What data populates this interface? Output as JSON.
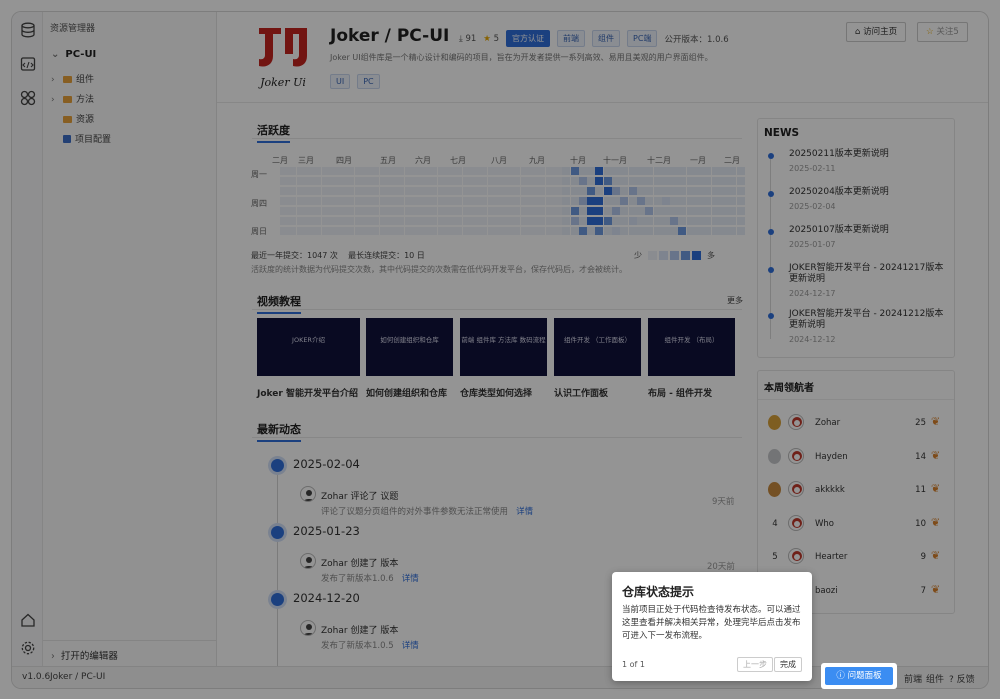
{
  "explorer": {
    "title": "资源管理器",
    "project": "PC-UI",
    "items": [
      {
        "label": "组件",
        "kind": "folder",
        "expandable": true
      },
      {
        "label": "方法",
        "kind": "folder",
        "expandable": true
      },
      {
        "label": "资源",
        "kind": "folder",
        "expandable": false
      },
      {
        "label": "项目配置",
        "kind": "file",
        "expandable": false
      }
    ],
    "open_editors": "打开的编辑器"
  },
  "statusbar": {
    "version": "v1.0.6",
    "path": "Joker / PC-UI",
    "right_items": [
      "前端",
      "组件",
      "反馈"
    ]
  },
  "header": {
    "logo_text": "Joker Ui",
    "title": "Joker / PC-UI",
    "downloads": "91",
    "stars": "5",
    "tags": [
      "官方认证",
      "前端",
      "组件",
      "PC端"
    ],
    "version_label": "公开版本：1.0.6",
    "description": "Joker UI组件库是一个精心设计和编码的项目，旨在为开发者提供一系列高效、易用且美观的用户界面组件。",
    "chips": [
      "UI",
      "PC"
    ],
    "visit_button": "访问主页",
    "follow_button": "关注5"
  },
  "activity": {
    "title": "活跃度",
    "months": [
      "二月",
      "三月",
      "四月",
      "五月",
      "六月",
      "七月",
      "八月",
      "九月",
      "十月",
      "十一月",
      "十二月",
      "一月",
      "二月"
    ],
    "days": [
      "周一",
      "周四",
      "周日"
    ],
    "summary_commits": "最近一年提交：1047 次",
    "summary_streak": "最长连续提交：10 日",
    "note": "活跃度的统计数据为代码提交次数，其中代码提交的次数需在低代码开发平台，保存代码后，才会被统计。",
    "legend_less": "少",
    "legend_more": "多",
    "colors": [
      "#eef2f9",
      "#d9e4f6",
      "#b3c9ee",
      "#6f9be2",
      "#2f6fdb"
    ]
  },
  "videos": {
    "title": "视频教程",
    "more": "更多",
    "items": [
      {
        "thumb": "JOKER介绍",
        "label": "Joker 智能开发平台介绍"
      },
      {
        "thumb": "如何创建组织和仓库",
        "label": "如何创建组织和仓库"
      },
      {
        "thumb": "前端 组件库 方法库 数码流程",
        "label": "仓库类型如何选择"
      },
      {
        "thumb": "组件开发 （工作面板）",
        "label": "认识工作面板"
      },
      {
        "thumb": "组件开发 （布局）",
        "label": "布局 - 组件开发"
      }
    ]
  },
  "feed": {
    "title": "最新动态",
    "groups": [
      {
        "date": "2025-02-04",
        "user": "Zohar",
        "action": "评论了 议题",
        "detail": "评论了议题分页组件的对外事件参数无法正常使用",
        "link": "详情",
        "ago": "9天前"
      },
      {
        "date": "2025-01-23",
        "user": "Zohar",
        "action": "创建了 版本",
        "detail": "发布了新版本1.0.6",
        "link": "详情",
        "ago": "20天前"
      },
      {
        "date": "2024-12-20",
        "user": "Zohar",
        "action": "创建了 版本",
        "detail": "发布了新版本1.0.5",
        "link": "详情",
        "ago": ""
      }
    ]
  },
  "news": {
    "title": "NEWS",
    "items": [
      {
        "title": "20250211版本更新说明",
        "date": "2025-02-11"
      },
      {
        "title": "20250204版本更新说明",
        "date": "2025-02-04"
      },
      {
        "title": "20250107版本更新说明",
        "date": "2025-01-07"
      },
      {
        "title": "JOKER智能开发平台 - 20241217版本更新说明",
        "date": "2024-12-17"
      },
      {
        "title": "JOKER智能开发平台 - 20241212版本更新说明",
        "date": "2024-12-12"
      }
    ]
  },
  "leaders": {
    "title": "本周领航者",
    "rows": [
      {
        "rank": "1",
        "name": "Zohar",
        "score": "25"
      },
      {
        "rank": "2",
        "name": "Hayden",
        "score": "14"
      },
      {
        "rank": "3",
        "name": "akkkkk",
        "score": "11"
      },
      {
        "rank": "4",
        "name": "Who",
        "score": "10"
      },
      {
        "rank": "5",
        "name": "Hearter",
        "score": "9"
      },
      {
        "rank": "6",
        "name": "baozi",
        "score": "7"
      }
    ]
  },
  "tour": {
    "title": "仓库状态提示",
    "body": "当前项目正处于代码检查待发布状态。可以通过这里查看并解决相关异常，处理完毕后点击发布可进入下一发布流程。",
    "counter": "1 of 1",
    "prev": "上一步",
    "done": "完成",
    "target_button": "问题面板"
  }
}
